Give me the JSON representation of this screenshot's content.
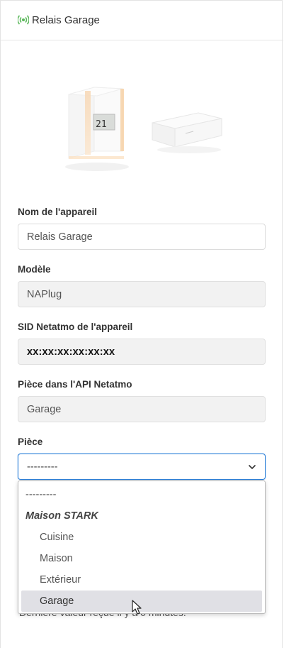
{
  "header": {
    "title": "Relais Garage",
    "icon": "wifi-signal-icon",
    "icon_color": "#5cb85c"
  },
  "product_image": {
    "description_icon": "thermostat-and-relay-image",
    "thermostat_display": "21"
  },
  "fields": {
    "device_name": {
      "label": "Nom de l'appareil",
      "value": "Relais Garage"
    },
    "model": {
      "label": "Modèle",
      "value": "NAPlug"
    },
    "sid": {
      "label": "SID Netatmo de l'appareil",
      "value": "xx:xx:xx:xx:xx:xx"
    },
    "api_room": {
      "label": "Pièce dans l'API Netatmo",
      "value": "Garage"
    },
    "room": {
      "label": "Pièce",
      "selected": "---------"
    }
  },
  "dropdown": {
    "placeholder": "---------",
    "group": "Maison STARK",
    "options": [
      "Cuisine",
      "Maison",
      "Extérieur",
      "Garage"
    ],
    "highlighted": "Garage"
  },
  "footer_text": "Dernière valeur reçue il y a 0 minutes.",
  "colors": {
    "focus_border": "#2b7fd8",
    "highlight_bg": "#e0e0e5",
    "readonly_bg": "#f2f2f2"
  }
}
